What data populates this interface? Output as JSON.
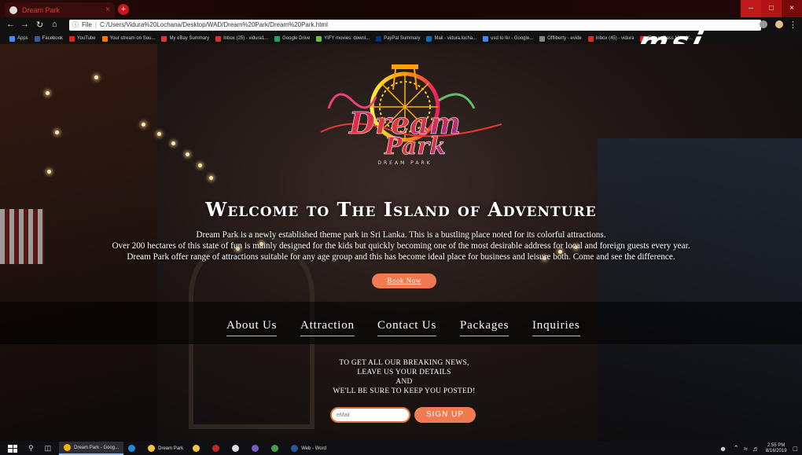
{
  "browser": {
    "tab_title": "Dream Park",
    "tab_close": "×",
    "new_tab": "+",
    "url_prefix": "File",
    "url": "C:/Users/Vidura%20Lochana/Desktop/WAD/Dream%20Park/Dream%20Park.html",
    "window_buttons": [
      "–",
      "□",
      "×"
    ],
    "bookmarks": [
      {
        "label": "Apps",
        "color": "#4a8af4"
      },
      {
        "label": "Facebook",
        "color": "#3b5998"
      },
      {
        "label": "YouTube",
        "color": "#e62117"
      },
      {
        "label": "Your stream on Sou...",
        "color": "#ff7700"
      },
      {
        "label": "My eBay Summary",
        "color": "#e53238"
      },
      {
        "label": "Inbox (25) - vidura1...",
        "color": "#d93025"
      },
      {
        "label": "Google Drive",
        "color": "#1fa463"
      },
      {
        "label": "YIFY movies: downl...",
        "color": "#6ac045"
      },
      {
        "label": "PayPal Summary",
        "color": "#003087"
      },
      {
        "label": "Mail - vidura.locha...",
        "color": "#0072c6"
      },
      {
        "label": "usd to lkr - Google...",
        "color": "#4285f4"
      },
      {
        "label": "Offliberty - evide",
        "color": "#888888"
      },
      {
        "label": "Inbox (45) - vidura",
        "color": "#d93025"
      },
      {
        "label": "Future Bass Mix - Y...",
        "color": "#e62117"
      }
    ],
    "overlay_logo": "msi"
  },
  "page": {
    "logo_small_text": "DREAM PARK",
    "hero_title": "Welcome to The Island of Adventure",
    "hero_lines": [
      "Dream Park is a newly established theme park in Sri Lanka. This is a bustling place noted for its colorful attractions.",
      "Over 200 hectares of this state of fun is mainly designed for the kids but quickly becoming one of the most desirable address for local and foreign guests every year.",
      "Dream Park offer range of attractions suitable for any age group and this has become ideal place for business and leisure both. Come and see the difference."
    ],
    "book_now": "Book Now",
    "nav": [
      "About Us",
      "Attraction",
      "Contact Us",
      "Packages",
      "Inquiries"
    ],
    "newsletter_lines": [
      "TO GET ALL OUR BREAKING NEWS,",
      "LEAVE US YOUR DETAILS",
      "AND",
      "WE'LL BE SURE TO KEEP YOU POSTED!"
    ],
    "email_placeholder": "eMail",
    "signup": "SIGN UP",
    "accent_color": "#f07a52"
  },
  "taskbar": {
    "apps": [
      {
        "label": "Dream Park - Goog...",
        "color": "#f4b400",
        "active": true
      },
      {
        "label": "",
        "color": "#1e88e5",
        "active": false
      },
      {
        "label": "Dream Park",
        "color": "#f6c344",
        "active": false
      },
      {
        "label": "",
        "color": "#f6c344",
        "active": false
      },
      {
        "label": "",
        "color": "#c62828",
        "active": false
      },
      {
        "label": "",
        "color": "#dddddd",
        "active": false
      },
      {
        "label": "",
        "color": "#7e57c2",
        "active": false
      },
      {
        "label": "",
        "color": "#43a047",
        "active": false
      },
      {
        "label": "Web - Word",
        "color": "#2b579a",
        "active": false
      }
    ],
    "time": "2:55 PM",
    "date": "8/16/2019"
  }
}
